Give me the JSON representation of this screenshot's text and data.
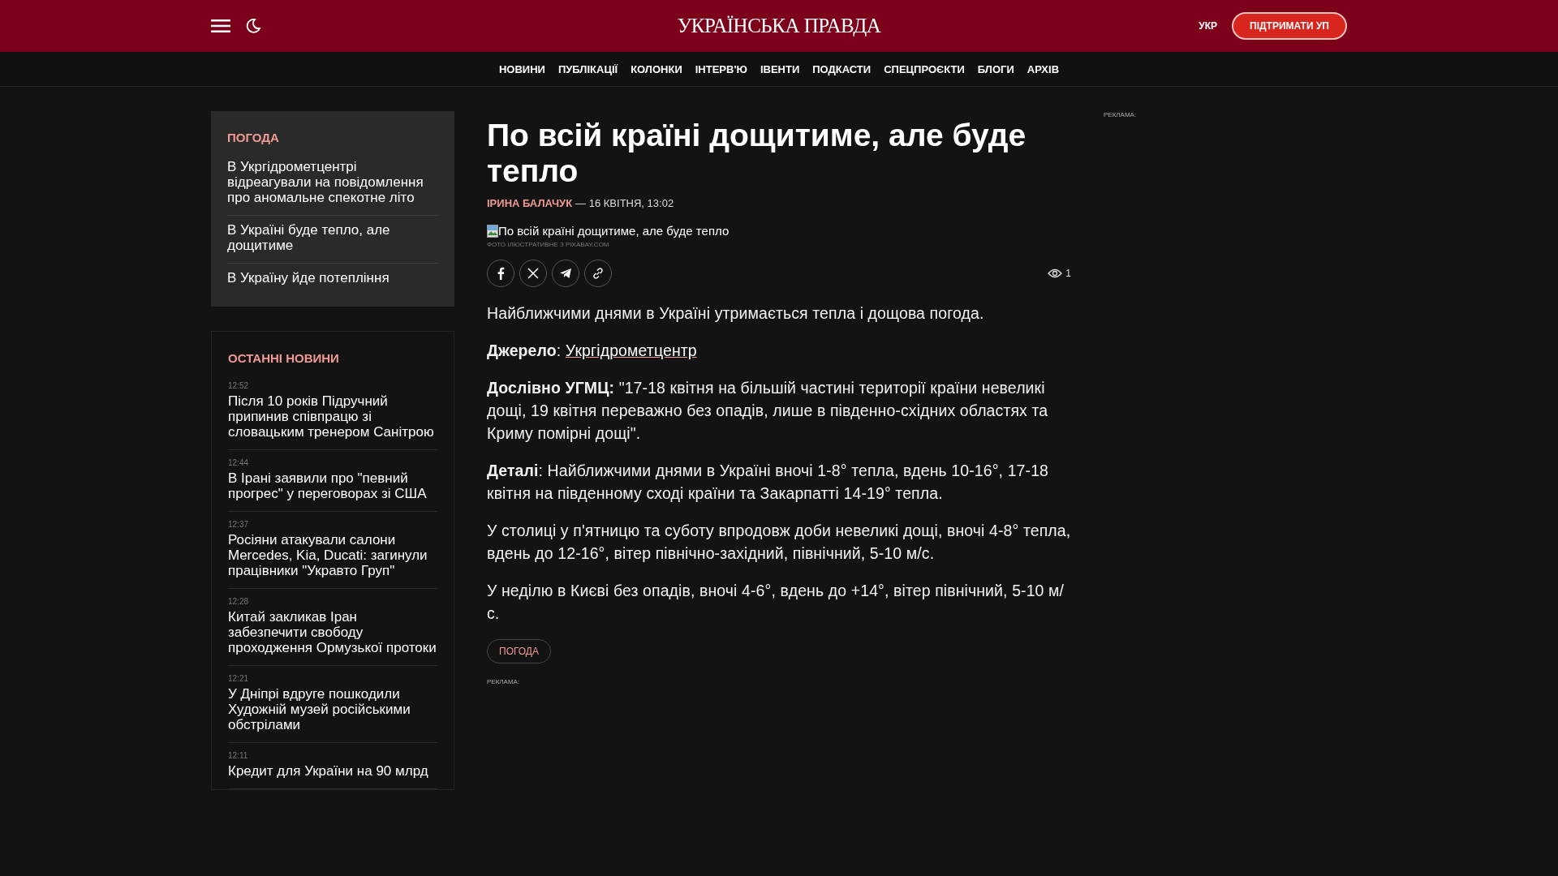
{
  "header": {
    "logo": "УКРАЇНСЬКА ПРАВДА",
    "language": "УКР",
    "support_button": "ПІДТРИМАТИ УП"
  },
  "nav": [
    "НОВИНИ",
    "ПУБЛІКАЦІЇ",
    "КОЛОНКИ",
    "ІНТЕРВ'Ю",
    "ІВЕНТИ",
    "ПОДКАСТИ",
    "СПЕЦПРОЄКТИ",
    "БЛОГИ",
    "АРХІВ"
  ],
  "weather": {
    "title": "ПОГОДА",
    "items": [
      "В Укргідрометцентрі відреагували на повідомлення про аномальне спекотне літо",
      "В Україні буде тепло, але дощитиме",
      "В Україну йде потепління"
    ]
  },
  "latest": {
    "title": "ОСТАННІ НОВИНИ",
    "items": [
      {
        "time": "12:52",
        "title": "Після 10 років Підручний припинив співпрацю зі словацьким тренером Санітрою"
      },
      {
        "time": "12:44",
        "title": "В Ірані заявили про \"певний прогрес\" у переговорах зі США"
      },
      {
        "time": "12:37",
        "title": "Росіяни атакували салони Mercedes, Kia, Ducati: загинули працівники \"Укравто Груп\""
      },
      {
        "time": "12:28",
        "title": "Китай закликав Іран забезпечити свободу проходження Ормузької протоки"
      },
      {
        "time": "12:21",
        "title": "У Дніпрі вдруге пошкодили Художній музей російськими обстрілами"
      },
      {
        "time": "12:11",
        "title": "Кредит для України на 90 млрд"
      }
    ]
  },
  "article": {
    "title": "По всій країні дощитиме, але буде тепло",
    "author": "ІРИНА БАЛАЧУК",
    "date": "— 16 КВІТНЯ, 13:02",
    "image_alt": "По всій країні дощитиме, але буде тепло",
    "image_caption": "ФОТО ІЛЮСТРАТИВНЕ З PIXABAY.COM",
    "views": "1",
    "paragraphs": [
      {
        "kind": "text",
        "text": "Найближчими днями в Україні утримається тепла і дощова погода."
      },
      {
        "kind": "source",
        "lead": "**Джерело**: ",
        "link": "Укргідрометцентр"
      },
      {
        "kind": "text",
        "text": "**Дослівно УГМЦ:** \"17-18 квітня на більшій частині території країни невеликі дощі, 19 квітня переважно без опадів, лише в південно-східних областях та Криму помірні дощі\"."
      },
      {
        "kind": "text",
        "text": "**Деталі**: Найближчими днями в Україні вночі 1-8° тепла, вдень 10-16°, 17-18 квітня на південному сході країни та Закарпатті 14-19° тепла."
      },
      {
        "kind": "text",
        "text": "У столиці у п'ятницю та суботу впродовж доби невеликі дощі, вночі 4-8° тепла, вдень до 12-16°, вітер північно-західний, північний, 5-10 м/с."
      },
      {
        "kind": "text",
        "text": "У неділю в Києві без опадів, вночі 4-6°, вдень до +14°, вітер північний, 5-10 м/с."
      }
    ],
    "tag": "ПОГОДА",
    "ad_label": "РЕКЛАМА:"
  },
  "right_ad_label": "РЕКЛАМА:"
}
